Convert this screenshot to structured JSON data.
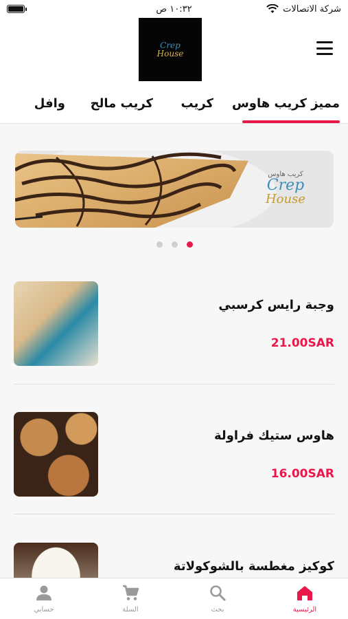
{
  "status_bar": {
    "carrier": "شركة الاتصالات",
    "time": "١٠:٣٢ ص"
  },
  "header": {
    "logo": {
      "line1": "Crep",
      "line2": "House"
    },
    "menu_icon": "hamburger-icon"
  },
  "tabs": [
    {
      "label": "مميز كريب هاوس",
      "active": true
    },
    {
      "label": "كريب",
      "active": false
    },
    {
      "label": "كريب مالح",
      "active": false
    },
    {
      "label": "وافل",
      "active": false
    }
  ],
  "banner": {
    "logo_top": "كريب هاوس",
    "logo_crep": "Crep",
    "logo_house": "House",
    "slides": 3,
    "active_slide": 3
  },
  "products": [
    {
      "name": "وجبة رايس كرسبي",
      "price": "21.00SAR"
    },
    {
      "name": "هاوس ستيك  فراولة",
      "price": "16.00SAR"
    },
    {
      "name": "كوكيز مغطسة بالشوكولاتة",
      "price": ""
    }
  ],
  "bottom_nav": [
    {
      "label": "الرئيسية",
      "icon": "home-icon",
      "active": true
    },
    {
      "label": "بحث",
      "icon": "search-icon",
      "active": false
    },
    {
      "label": "السلة",
      "icon": "cart-icon",
      "active": false
    },
    {
      "label": "حسابي",
      "icon": "person-icon",
      "active": false
    }
  ],
  "colors": {
    "accent": "#e8194a",
    "inactive": "#9a9a9a"
  }
}
